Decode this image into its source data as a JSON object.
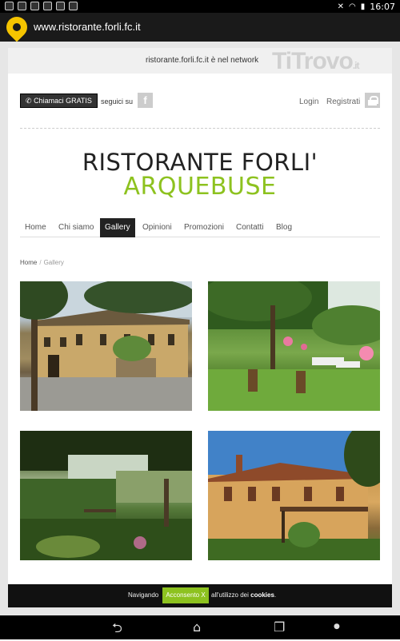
{
  "status_bar": {
    "clock": "16:07",
    "icons": [
      "gallery-icon",
      "calendar-icon",
      "image-icon",
      "image-icon",
      "email-icon",
      "download-icon"
    ],
    "right_icons": [
      "mute-icon",
      "wifi-icon",
      "battery-icon"
    ]
  },
  "url_bar": {
    "url": "www.ristorante.forli.fc.it"
  },
  "network_bar": {
    "domain": "ristorante.forli.fc.it",
    "suffix": " è nel network",
    "brand": "TiTrovo",
    "brand_tld": ".it"
  },
  "topbar": {
    "call_label": "Chiamaci GRATIS",
    "follow_label": "seguici su",
    "login_label": "Login",
    "register_label": "Registrati"
  },
  "header": {
    "line1": "RISTORANTE FORLI'",
    "line2": "ARQUEBUSE",
    "accent_color": "#8dc21f"
  },
  "nav": {
    "items": [
      {
        "label": "Home"
      },
      {
        "label": "Chi siamo"
      },
      {
        "label": "Gallery",
        "active": true
      },
      {
        "label": "Opinioni"
      },
      {
        "label": "Promozioni"
      },
      {
        "label": "Contatti"
      },
      {
        "label": "Blog"
      }
    ]
  },
  "breadcrumb": {
    "home": "Home",
    "separator": "/",
    "current": "Gallery"
  },
  "gallery": {
    "photos": [
      {
        "subject": "restaurant-building-exterior"
      },
      {
        "subject": "garden-tables-with-balloons"
      },
      {
        "subject": "garden-pergola-benches"
      },
      {
        "subject": "restaurant-exterior-terrace"
      }
    ]
  },
  "cookie_banner": {
    "prefix": "Navigando",
    "button": "Acconsento X",
    "suffix": "all'utilizzo dei",
    "link": "cookies",
    "end": "."
  },
  "android_nav": {
    "back": "back-icon",
    "home": "home-icon",
    "recents": "recents-icon"
  }
}
